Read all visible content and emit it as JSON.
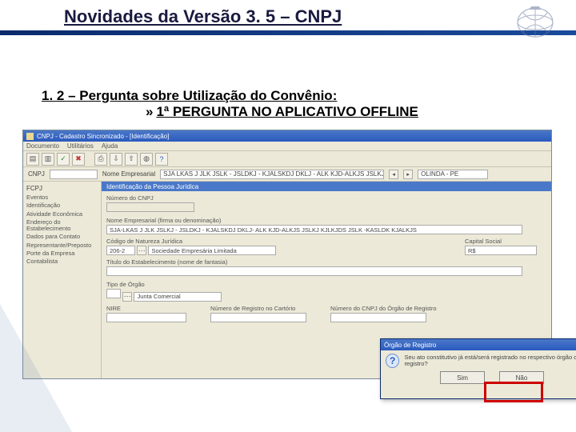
{
  "slide": {
    "title": "Novidades da Versão 3. 5 – CNPJ",
    "subtitle1": "1. 2 – Pergunta sobre Utilização do Convênio:",
    "subtitle_bullet": "»",
    "subtitle2": "1ª PERGUNTA NO APLICATIVO OFFLINE"
  },
  "app": {
    "window_title": "CNPJ - Cadastro Sincronizado - [Identificação]",
    "menus": [
      "Documento",
      "Utilitários",
      "Ajuda"
    ],
    "docbar": {
      "label_cnpj": "CNPJ",
      "field_cnpj": "",
      "label_nome": "Nome Empresarial",
      "field_nome": "SJA LKAS J JLK JSLK - JSLDKJ - KJALSKDJ DKLJ - ALK  KJD-ALKJS  JSLKJ  KJLKJDS  JSLK -KASLDK  KJALKJS",
      "municipio": "OLINDA - PE"
    },
    "sidebar": {
      "title": "FCPJ",
      "items": [
        "Eventos",
        "Identificação",
        "Atividade Econômica",
        "Endereço do Estabelecimento",
        "Dados para Contato",
        "Representante/Preposto",
        "Porte da Empresa",
        "Contabilista"
      ]
    },
    "panel": {
      "header": "Identificação da Pessoa Jurídica",
      "label_numero_cnpj": "Número do CNPJ",
      "label_nome_emp": "Nome Empresarial (firma ou denominação)",
      "value_nome_emp": "SJA-LKAS J JLK JSLKJ - JSLDKJ - KJALSKDJ DKLJ- ALK  KJD-ALKJS  JSLKJ  KJLKJDS  JSLK -KASLDK  KJALKJS",
      "label_cod_nat": "Código de Natureza Jurídica",
      "value_cod_nat_code": "206-2",
      "value_cod_nat_desc": "Sociedade Empresária Limitada",
      "label_capital": "Capital Social",
      "value_capital": "R$",
      "label_titulo": "Título do Estabelecimento (nome de fantasia)",
      "label_tipo_orgao": "Tipo de Órgão",
      "value_tipo_orgao": "Junta Comercial",
      "label_nire": "NIRE",
      "label_num_reg": "Número de Registro no Cartório",
      "label_num_cnpj_orgao": "Número do CNPJ do Órgão de Registro"
    }
  },
  "dialog": {
    "title": "Órgão de Registro",
    "message": "Seu ato constitutivo já está/será registrado no respectivo órgão de registro?",
    "btn_yes": "Sim",
    "btn_no": "Não"
  }
}
